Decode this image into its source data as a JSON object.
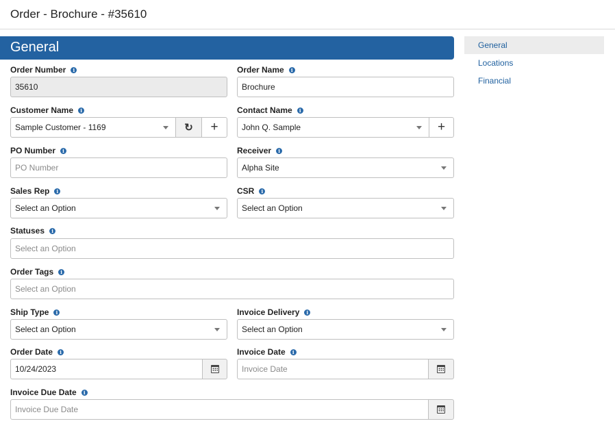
{
  "header": {
    "title": "Order - Brochure - #35610"
  },
  "section": {
    "title": "General"
  },
  "fields": {
    "order_number": {
      "label": "Order Number",
      "value": "35610"
    },
    "order_name": {
      "label": "Order Name",
      "value": "Brochure"
    },
    "customer_name": {
      "label": "Customer Name",
      "value": "Sample Customer - 1169"
    },
    "contact_name": {
      "label": "Contact Name",
      "value": "John Q. Sample"
    },
    "po_number": {
      "label": "PO Number",
      "placeholder": "PO Number"
    },
    "receiver": {
      "label": "Receiver",
      "value": "Alpha Site"
    },
    "sales_rep": {
      "label": "Sales Rep",
      "value": "Select an Option"
    },
    "csr": {
      "label": "CSR",
      "value": "Select an Option"
    },
    "statuses": {
      "label": "Statuses",
      "placeholder": "Select an Option"
    },
    "order_tags": {
      "label": "Order Tags",
      "placeholder": "Select an Option"
    },
    "ship_type": {
      "label": "Ship Type",
      "value": "Select an Option"
    },
    "invoice_delivery": {
      "label": "Invoice Delivery",
      "value": "Select an Option"
    },
    "order_date": {
      "label": "Order Date",
      "value": "10/24/2023"
    },
    "invoice_date": {
      "label": "Invoice Date",
      "placeholder": "Invoice Date"
    },
    "invoice_due_date": {
      "label": "Invoice Due Date",
      "placeholder": "Invoice Due Date"
    }
  },
  "buttons": {
    "refresh_icon": "↻",
    "add_icon": "+"
  },
  "info_icon": "i",
  "side_nav": {
    "items": [
      {
        "label": "General",
        "active": true
      },
      {
        "label": "Locations",
        "active": false
      },
      {
        "label": "Financial",
        "active": false
      }
    ]
  },
  "colors": {
    "section_bar": "#2362a1",
    "link": "#1e5f9e",
    "info_icon": "#2a6aaa"
  }
}
